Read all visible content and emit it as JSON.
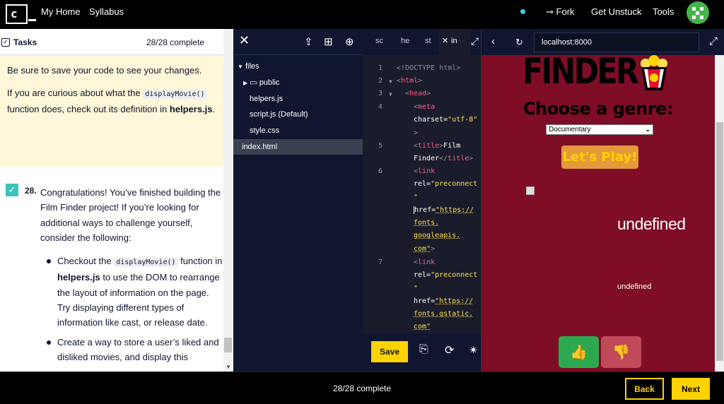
{
  "nav": {
    "my_home": "My Home",
    "syllabus": "Syllabus",
    "fork": "Fork",
    "get_unstuck": "Get Unstuck",
    "tools": "Tools"
  },
  "tasks": {
    "title": "Tasks",
    "count": "28/28 complete"
  },
  "hint": {
    "p1": "Be sure to save your code to see your changes.",
    "p2a": "If you are curious about what the ",
    "p2code": "displayMovie()",
    "p2b": " function does, check out its definition in ",
    "p2file": "helpers.js",
    "p2end": "."
  },
  "task28": {
    "number": "28.",
    "text": "Congratulations! You’ve finished building the Film Finder project! If you’re looking for additional ways to challenge yourself, consider the following:",
    "bullet1a": "Checkout the ",
    "bullet1code": "displayMovie()",
    "bullet1b": " function in ",
    "bullet1file": "helpers.js",
    "bullet1c": " to use the DOM to rearrange the layout of information on the page. Try displaying different types of information like cast, or release date.",
    "bullet2": "Create a way to store a user’s liked and disliked movies, and display this"
  },
  "files": {
    "root": "files",
    "folder": "public",
    "items": [
      "helpers.js",
      "script.js (Default)",
      "style.css",
      "index.html"
    ]
  },
  "editor": {
    "tabs": [
      "sc",
      "he",
      "st",
      "in"
    ],
    "save_label": "Save",
    "line_numbers": [
      "1",
      "2",
      "3",
      "4",
      "5",
      "6",
      "7"
    ]
  },
  "browser": {
    "url": "localhost:8000",
    "finder": "FINDER",
    "genre_heading": "Choose a genre:",
    "genre_selected": "Documentary",
    "play_label": "Let's Play!",
    "movie_title": "undefined",
    "movie_overview": "undefined"
  },
  "footer": {
    "progress": "28/28 complete",
    "back": "Back",
    "next": "Next"
  },
  "colors": {
    "accent": "#ffd300",
    "check": "#3cc2b8",
    "viewport_bg": "#7e0d25"
  }
}
